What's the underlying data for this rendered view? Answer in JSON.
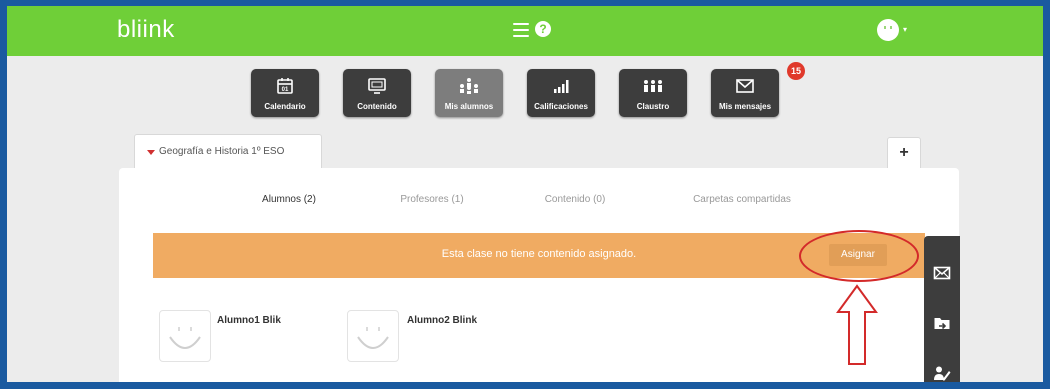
{
  "app": {
    "logo": "bliink",
    "brand_color": "#6fcf38"
  },
  "topbar": {
    "menu_icon": "hamburger-icon",
    "help_icon": "help-icon",
    "help_glyph": "?",
    "avatar_caret": "▾"
  },
  "toolbar": {
    "items": [
      {
        "label": "Calendario",
        "icon": "calendar-icon"
      },
      {
        "label": "Contenido",
        "icon": "monitor-icon"
      },
      {
        "label": "Mis alumnos",
        "icon": "students-icon",
        "active": true
      },
      {
        "label": "Calificaciones",
        "icon": "bar-chart-icon"
      },
      {
        "label": "Claustro",
        "icon": "teachers-icon"
      },
      {
        "label": "Mis mensajes",
        "icon": "envelope-icon"
      }
    ],
    "calendar_day": "01",
    "messages_badge": "15"
  },
  "class_tab": {
    "label": "Geografía e Historia 1º ESO"
  },
  "add_button": {
    "label": "+"
  },
  "subtabs": [
    {
      "label": "Alumnos (2)",
      "active": true
    },
    {
      "label": "Profesores (1)"
    },
    {
      "label": "Contenido (0)"
    },
    {
      "label": "Carpetas compartidas"
    }
  ],
  "banner": {
    "message": "Esta clase no tiene contenido asignado.",
    "button_label": "Asignar",
    "color": "#f0ab62"
  },
  "students": [
    {
      "name": "Alumno1 Blik"
    },
    {
      "name": "Alumno2 Blink"
    }
  ],
  "side_toolbar": {
    "icons": [
      "envelope-icon",
      "folder-share-icon",
      "edit-user-icon"
    ]
  },
  "annotation": {
    "color": "#d32a2a"
  }
}
